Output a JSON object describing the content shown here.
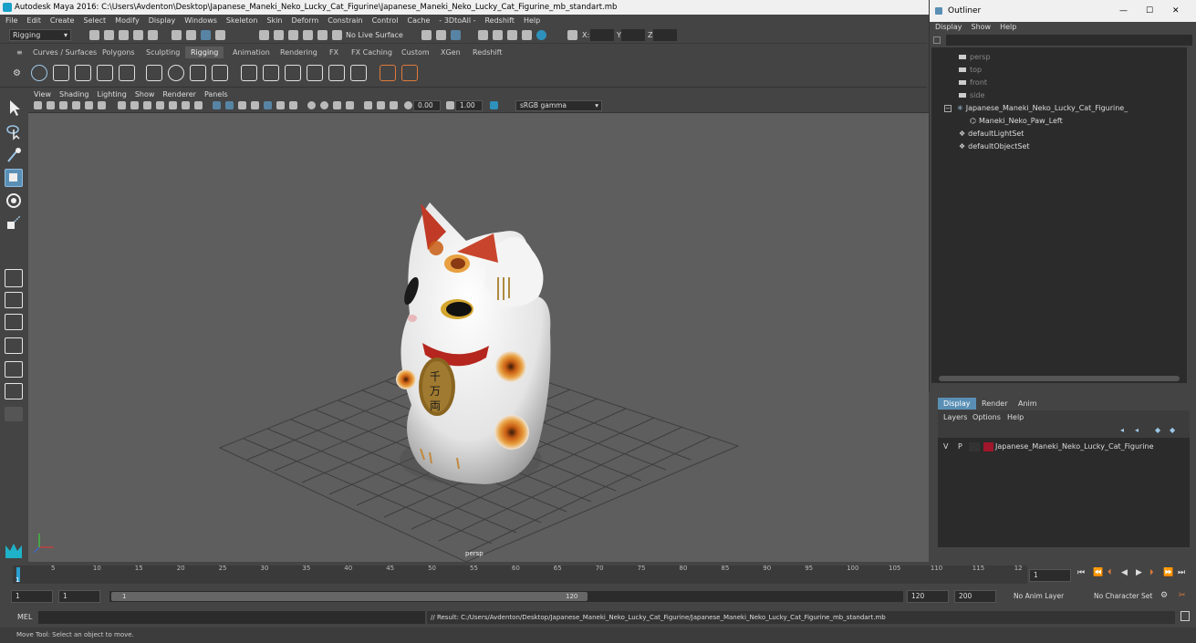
{
  "window_title": "Autodesk Maya 2016: C:\\Users\\Avdenton\\Desktop\\Japanese_Maneki_Neko_Lucky_Cat_Figurine\\Japanese_Maneki_Neko_Lucky_Cat_Figurine_mb_standart.mb",
  "menu": [
    "File",
    "Edit",
    "Create",
    "Select",
    "Modify",
    "Display",
    "Windows",
    "Skeleton",
    "Skin",
    "Deform",
    "Constrain",
    "Control",
    "Cache",
    "- 3DtoAll -",
    "Redshift",
    "Help"
  ],
  "status": {
    "mode": "Rigging",
    "live_surface": "No Live Surface",
    "x_label": "X:",
    "y_label": "Y:",
    "z_label": "Z:"
  },
  "shelf_tabs": [
    "Curves / Surfaces",
    "Polygons",
    "Sculpting",
    "Rigging",
    "Animation",
    "Rendering",
    "FX",
    "FX Caching",
    "Custom",
    "XGen",
    "Redshift"
  ],
  "active_shelf": "Rigging",
  "viewport": {
    "menu": [
      "View",
      "Shading",
      "Lighting",
      "Show",
      "Renderer",
      "Panels"
    ],
    "exposure": "0.00",
    "gamma": "1.00",
    "color_space": "sRGB gamma",
    "camera_label": "persp"
  },
  "outliner": {
    "title": "Outliner",
    "menu": [
      "Display",
      "Show",
      "Help"
    ],
    "items": [
      "persp",
      "top",
      "front",
      "side",
      "Japanese_Maneki_Neko_Lucky_Cat_Figurine_",
      "Maneki_Neko_Paw_Left",
      "defaultLightSet",
      "defaultObjectSet"
    ]
  },
  "channel": {
    "tabs": [
      "Display",
      "Render",
      "Anim"
    ],
    "menu": [
      "Layers",
      "Options",
      "Help"
    ],
    "layer": {
      "v": "V",
      "p": "P",
      "name": "Japanese_Maneki_Neko_Lucky_Cat_Figurine",
      "color": "#a0162a"
    }
  },
  "timeline": {
    "ticks": [
      "5",
      "10",
      "15",
      "20",
      "25",
      "30",
      "35",
      "40",
      "45",
      "50",
      "55",
      "60",
      "65",
      "70",
      "75",
      "80",
      "85",
      "90",
      "95",
      "100",
      "105",
      "110",
      "115",
      "12"
    ],
    "current_marker": "1",
    "current_frame": "1"
  },
  "range": {
    "start": "1",
    "anim_start": "1",
    "slider_start": "1",
    "slider_end": "120",
    "end": "120",
    "anim_end": "200",
    "anim_layer": "No Anim Layer",
    "character_set": "No Character Set"
  },
  "mel": {
    "label": "MEL",
    "result": "// Result: C:/Users/Avdenton/Desktop/Japanese_Maneki_Neko_Lucky_Cat_Figurine/Japanese_Maneki_Neko_Lucky_Cat_Figurine_mb_standart.mb"
  },
  "help_line": "Move Tool: Select an object to move."
}
